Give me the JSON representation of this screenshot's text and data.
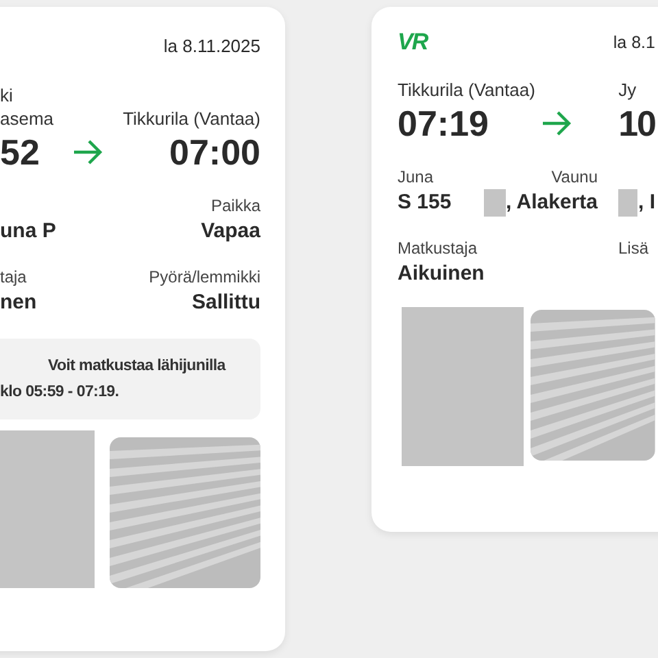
{
  "tickets": [
    {
      "date": "la 8.11.2025",
      "from": {
        "station": "ki",
        "station_line2": "asema",
        "time": "52"
      },
      "to": {
        "station": "Tikkurila (Vantaa)",
        "time": "07:00"
      },
      "rows": [
        {
          "kind": "split",
          "left": {
            "value": "una P"
          },
          "right": {
            "label": "Paikka",
            "value": "Vapaa"
          }
        },
        {
          "kind": "split",
          "left": {
            "label": "taja",
            "value": "nen"
          },
          "right": {
            "label": "Pyörä/lemmikki",
            "value": "Sallittu"
          }
        }
      ],
      "notice": "Voit matkustaa lähijunilla klo 05:59 - 07:19."
    },
    {
      "logo": "VR",
      "date": "la 8.1",
      "from": {
        "station": "Tikkurila (Vantaa)",
        "time": "07:19"
      },
      "to": {
        "station": "Jy",
        "time": "10"
      },
      "rows": [
        {
          "kind": "three",
          "fields": [
            {
              "label": "Juna",
              "value": "S 155",
              "redacted": false
            },
            {
              "label": "Vaunu",
              "value": ", Alakerta",
              "redacted": true
            },
            {
              "value": ", I",
              "redacted": true
            }
          ]
        },
        {
          "kind": "split",
          "left": {
            "label": "Matkustaja",
            "value": "Aikuinen"
          },
          "right": {
            "label": "Lisä"
          }
        }
      ]
    }
  ]
}
